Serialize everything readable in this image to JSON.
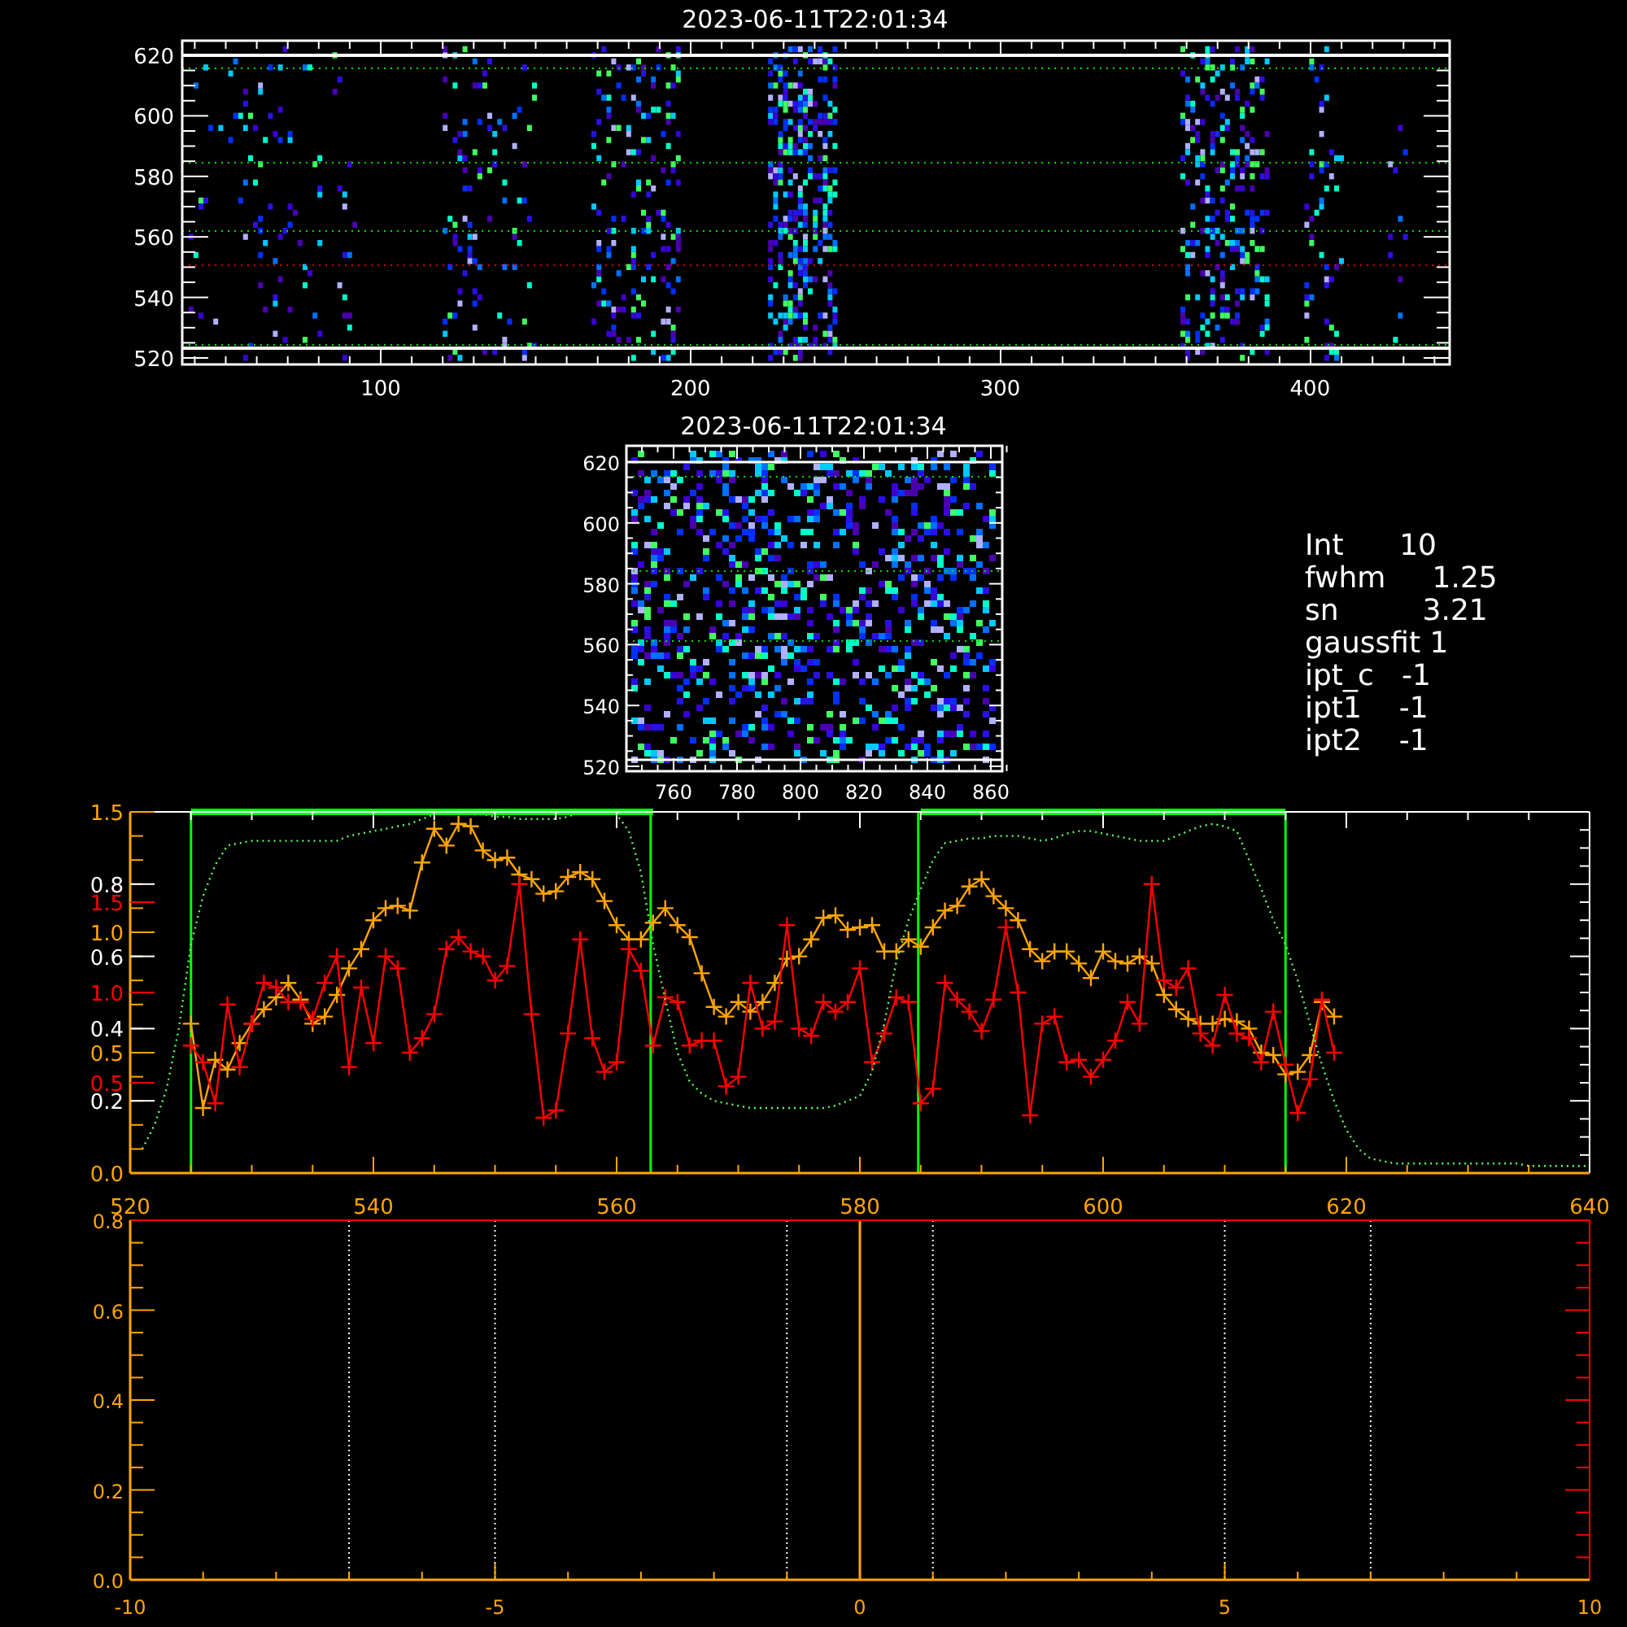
{
  "top_image": {
    "title": "2023-06-11T22:01:34",
    "yticks": [
      "620",
      "600",
      "580",
      "560",
      "540",
      "520"
    ],
    "xticks": [
      "100",
      "200",
      "300",
      "400"
    ]
  },
  "zoom_image": {
    "title": "2023-06-11T22:01:34",
    "yticks": [
      "620",
      "600",
      "580",
      "560",
      "540",
      "520"
    ],
    "xticks": [
      "760",
      "780",
      "800",
      "820",
      "840",
      "860"
    ]
  },
  "fit_parameters": [
    "Int      10",
    "fwhm     1.25",
    "sn         3.21",
    "gaussfit 1",
    "ipt_c   -1",
    "ipt1    -1",
    "ipt2    -1"
  ],
  "profile_plot": {
    "chart_data": {
      "type": "line",
      "x": [
        521,
        522,
        523,
        524,
        525,
        526,
        527,
        528,
        529,
        530,
        531,
        532,
        533,
        534,
        535,
        536,
        537,
        538,
        539,
        540,
        541,
        542,
        543,
        544,
        545,
        546,
        547,
        548,
        549,
        550,
        551,
        552,
        553,
        554,
        555,
        556,
        557,
        558,
        559,
        560,
        561,
        562,
        563,
        564,
        565,
        566,
        567,
        568,
        569,
        570,
        571,
        572,
        573,
        574,
        575,
        576,
        577,
        578,
        579,
        580,
        581,
        582,
        583,
        584,
        585,
        586,
        587,
        588,
        589,
        590,
        591,
        592,
        593,
        594,
        595,
        596,
        597,
        598,
        599,
        600,
        601,
        602,
        603,
        604,
        605,
        606,
        607,
        608,
        609,
        610,
        611,
        612,
        613,
        614,
        615,
        616,
        617,
        618,
        619,
        620,
        621,
        622,
        623,
        624,
        625,
        626,
        627,
        628,
        629,
        630,
        631,
        632,
        633,
        634,
        635,
        636,
        637,
        638,
        639,
        640
      ],
      "series": [
        {
          "color": "#ffa500",
          "marker": "+",
          "values": [
            null,
            null,
            null,
            null,
            0.62,
            0.27,
            0.47,
            0.43,
            0.54,
            0.62,
            0.68,
            0.73,
            0.79,
            0.72,
            0.62,
            0.65,
            0.74,
            0.85,
            0.93,
            1.05,
            1.1,
            1.11,
            1.09,
            1.29,
            1.43,
            1.36,
            1.45,
            1.44,
            1.34,
            1.3,
            1.31,
            1.24,
            1.22,
            1.16,
            1.17,
            1.23,
            1.25,
            1.22,
            1.13,
            1.03,
            0.97,
            0.97,
            1.04,
            1.1,
            1.03,
            0.98,
            0.83,
            0.69,
            0.65,
            0.71,
            0.67,
            0.71,
            0.79,
            0.89,
            0.9,
            0.97,
            1.06,
            1.07,
            1.01,
            1.02,
            1.03,
            0.92,
            0.92,
            0.97,
            0.94,
            1.02,
            1.09,
            1.11,
            1.19,
            1.22,
            1.15,
            1.1,
            1.05,
            0.93,
            0.88,
            0.92,
            0.92,
            0.87,
            0.81,
            0.92,
            0.88,
            0.87,
            0.9,
            0.87,
            0.74,
            0.68,
            0.64,
            0.62,
            0.62,
            0.64,
            0.63,
            0.6,
            0.5,
            0.49,
            0.41,
            0.42,
            0.49,
            0.71,
            0.65,
            null,
            null,
            null,
            null,
            null,
            null,
            null,
            null,
            null,
            null,
            null,
            null,
            null,
            null,
            null,
            null,
            null,
            null,
            null,
            null,
            null
          ]
        },
        {
          "color": "#ff0000",
          "marker": "+",
          "values": [
            null,
            null,
            null,
            null,
            0.53,
            0.46,
            0.29,
            0.7,
            0.44,
            0.62,
            0.79,
            0.77,
            0.71,
            0.71,
            0.64,
            0.79,
            0.9,
            0.44,
            0.77,
            0.54,
            0.9,
            0.85,
            0.5,
            0.56,
            0.66,
            0.93,
            0.98,
            0.92,
            0.9,
            0.8,
            0.86,
            1.2,
            0.66,
            0.23,
            0.26,
            0.58,
            0.97,
            0.56,
            0.42,
            0.46,
            0.93,
            0.84,
            0.53,
            0.73,
            0.71,
            0.53,
            0.55,
            0.55,
            0.36,
            0.4,
            0.79,
            0.6,
            0.63,
            1.03,
            0.6,
            0.57,
            0.71,
            0.67,
            0.71,
            0.85,
            0.46,
            0.58,
            0.73,
            0.71,
            0.29,
            0.35,
            0.79,
            0.72,
            0.67,
            0.59,
            0.72,
            1.02,
            0.75,
            0.24,
            0.62,
            0.65,
            0.46,
            0.47,
            0.4,
            0.47,
            0.55,
            0.71,
            0.62,
            1.2,
            0.8,
            0.77,
            0.85,
            0.58,
            0.53,
            0.74,
            0.58,
            0.56,
            0.46,
            0.67,
            0.45,
            0.25,
            0.39,
            0.72,
            0.5,
            null,
            null,
            null,
            null,
            null,
            null,
            null,
            null,
            null,
            null,
            null,
            null,
            null,
            null,
            null,
            null,
            null,
            null,
            null,
            null,
            null
          ]
        },
        {
          "color": "#60ff60",
          "line_style": "dotted",
          "values": [
            0.1,
            0.2,
            0.35,
            0.6,
            0.95,
            1.15,
            1.28,
            1.36,
            1.37,
            1.38,
            1.38,
            1.38,
            1.38,
            1.38,
            1.38,
            1.38,
            1.38,
            1.4,
            1.41,
            1.42,
            1.43,
            1.44,
            1.45,
            1.47,
            1.49,
            1.5,
            1.5,
            1.49,
            1.49,
            1.48,
            1.48,
            1.47,
            1.47,
            1.47,
            1.47,
            1.48,
            1.5,
            1.5,
            1.5,
            1.49,
            1.42,
            1.25,
            0.95,
            0.72,
            0.5,
            0.38,
            0.33,
            0.3,
            0.29,
            0.28,
            0.27,
            0.27,
            0.27,
            0.27,
            0.27,
            0.27,
            0.27,
            0.28,
            0.3,
            0.32,
            0.42,
            0.62,
            0.88,
            1.05,
            1.18,
            1.3,
            1.37,
            1.38,
            1.39,
            1.39,
            1.4,
            1.4,
            1.4,
            1.39,
            1.38,
            1.39,
            1.41,
            1.42,
            1.42,
            1.41,
            1.4,
            1.39,
            1.38,
            1.38,
            1.38,
            1.4,
            1.42,
            1.44,
            1.45,
            1.44,
            1.42,
            1.3,
            1.18,
            1.05,
            0.95,
            0.8,
            0.62,
            0.45,
            0.3,
            0.18,
            0.1,
            0.06,
            0.05,
            0.04,
            0.04,
            0.04,
            0.04,
            0.04,
            0.04,
            0.04,
            0.04,
            0.04,
            0.04,
            0.04,
            0.03,
            0.03,
            0.03,
            0.03,
            0.03,
            0.03
          ]
        },
        {
          "color": "#00ff00",
          "values": [
            null,
            null,
            null,
            null,
            1.5,
            1.5,
            1.5,
            1.5,
            1.5,
            1.5,
            1.5,
            1.5,
            1.5,
            1.5,
            1.5,
            1.5,
            1.5,
            1.5,
            1.5,
            1.5,
            1.5,
            1.5,
            1.5,
            1.5,
            1.5,
            1.5,
            1.5,
            1.5,
            1.5,
            1.5,
            1.5,
            1.5,
            1.5,
            1.5,
            1.5,
            1.5,
            1.5,
            1.5,
            1.5,
            1.5,
            1.5,
            1.5,
            1.5,
            null,
            null,
            null,
            null,
            null,
            null,
            null,
            null,
            null,
            null,
            null,
            null,
            null,
            null,
            null,
            null,
            null,
            null,
            null,
            null,
            null,
            1.5,
            1.5,
            1.5,
            1.5,
            1.5,
            1.5,
            1.5,
            1.5,
            1.5,
            1.5,
            1.5,
            1.5,
            1.5,
            1.5,
            1.5,
            1.5,
            1.5,
            1.5,
            1.5,
            1.5,
            1.5,
            1.5,
            1.5,
            1.5,
            1.5,
            1.5,
            1.5,
            1.5,
            1.5,
            1.5,
            1.5,
            null,
            null,
            null,
            null,
            null,
            null,
            null,
            null,
            null,
            null,
            null,
            null,
            null,
            null,
            null,
            null,
            null,
            null,
            null,
            null,
            null,
            null,
            null,
            null,
            null
          ]
        }
      ],
      "xlim": [
        520,
        640
      ],
      "ylim": [
        0,
        1.5
      ],
      "xticks": [
        520,
        540,
        560,
        580,
        600,
        620,
        640
      ],
      "yticks": [
        {
          "value": 0,
          "label": "0.0"
        },
        0.5,
        {
          "value": 1,
          "label": "1.0"
        },
        1.5
      ],
      "ref_lines": [
        {
          "axis": "x",
          "value": 525,
          "color": "#00ff00"
        },
        {
          "axis": "x",
          "value": 562.8,
          "color": "#00ff00"
        },
        {
          "axis": "x",
          "value": 584.8,
          "color": "#00ff00"
        },
        {
          "axis": "x",
          "value": 615,
          "color": "#00ff00"
        }
      ]
    },
    "red_axis_labels": [
      "1.5",
      "1.0",
      "0.5"
    ],
    "white_axis_labels": [
      "0.8",
      "0.6",
      "0.4",
      "0.2"
    ]
  },
  "offset_plot": {
    "chart_data": {
      "type": "line",
      "xlim": [
        -10,
        10
      ],
      "ylim": [
        0,
        0.8
      ],
      "xticks": [
        -10,
        -5,
        0,
        5,
        10
      ],
      "yticks": [
        {
          "value": 0,
          "label": "0.0"
        },
        0.2,
        0.4,
        0.6,
        0.8
      ],
      "ref_lines": [
        {
          "axis": "x",
          "value": -7,
          "color": "#ffffff"
        },
        {
          "axis": "x",
          "value": -5,
          "color": "#ffffff"
        },
        {
          "axis": "x",
          "value": -1,
          "color": "#ffffff"
        },
        {
          "axis": "x",
          "value": 0,
          "color": "#ffa500"
        },
        {
          "axis": "x",
          "value": 1,
          "color": "#ffffff"
        },
        {
          "axis": "x",
          "value": 5,
          "color": "#ffffff"
        },
        {
          "axis": "x",
          "value": 7,
          "color": "#ffffff"
        }
      ]
    }
  }
}
